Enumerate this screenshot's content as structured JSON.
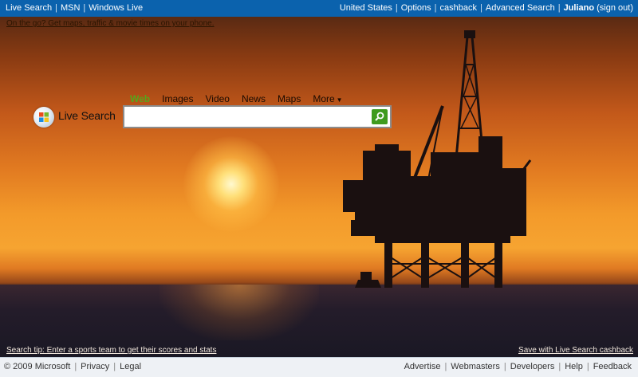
{
  "topbar": {
    "left_links": [
      "Live Search",
      "MSN",
      "Windows Live"
    ],
    "right_links": [
      "United States",
      "Options",
      "cashback",
      "Advanced Search"
    ],
    "user": "Juliano",
    "signout": "(sign out)"
  },
  "promo": "On the go? Get maps, traffic & movie times on your phone.",
  "logo": {
    "text": "Live Search",
    "icon": "windows-flag-icon"
  },
  "tabs": [
    {
      "label": "Web",
      "active": true
    },
    {
      "label": "Images"
    },
    {
      "label": "Video"
    },
    {
      "label": "News"
    },
    {
      "label": "Maps"
    },
    {
      "label": "More",
      "dropdown": true
    }
  ],
  "search": {
    "value": "",
    "button_icon": "search-icon"
  },
  "tip": "Search tip: Enter a sports team to get their scores and stats",
  "cashback_link": "Save with Live Search cashback",
  "footer": {
    "copyright": "© 2009 Microsoft",
    "left_links": [
      "Privacy",
      "Legal"
    ],
    "right_links": [
      "Advertise",
      "Webmasters",
      "Developers",
      "Help",
      "Feedback"
    ]
  },
  "colors": {
    "topbar": "#0b62ad",
    "active_tab": "#56a61c",
    "search_button": "#3f9b1e"
  }
}
